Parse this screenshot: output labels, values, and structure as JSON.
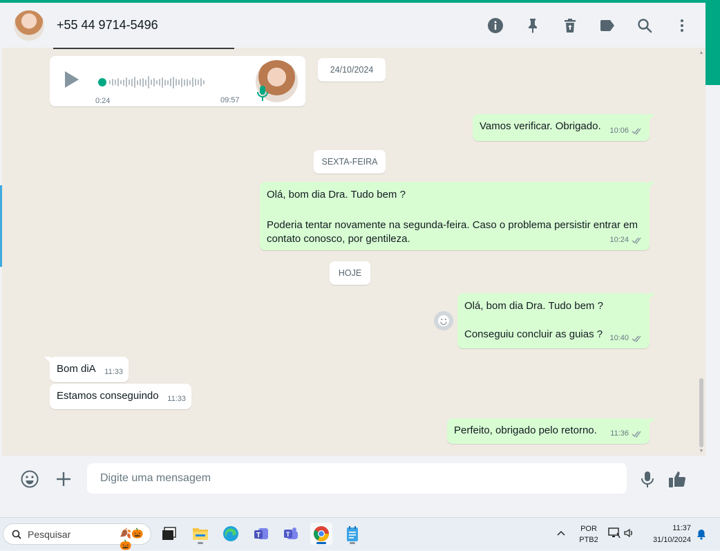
{
  "header": {
    "contact_name": "+55 44 9714-5496",
    "icons": [
      "info-icon",
      "pin-icon",
      "trash-icon",
      "label-icon",
      "search-icon",
      "menu-icon"
    ]
  },
  "voice_message": {
    "current_time": "0:24",
    "duration": "09:57",
    "progress": 0.0
  },
  "date_chips": {
    "d1": "24/10/2024",
    "d2": "SEXTA-FEIRA",
    "d3": "HOJE"
  },
  "messages": {
    "m1": {
      "text": "Vamos verificar. Obrigado.",
      "time": "10:06"
    },
    "m2": {
      "line1": "Olá, bom dia Dra. Tudo bem ?",
      "line2": "Poderia tentar novamente na segunda-feira. Caso o problema persistir entrar em contato conosco, por gentileza.",
      "time": "10:24"
    },
    "m3": {
      "line1": "Olá, bom dia Dra. Tudo bem ?",
      "line2": "Conseguiu concluir as guias ?",
      "time": "10:40"
    },
    "m4": {
      "text": "Bom diA",
      "time": "11:33"
    },
    "m5": {
      "text": "Estamos conseguindo",
      "time": "11:33"
    },
    "m6": {
      "text": "Perfeito, obrigado pelo retorno.",
      "time": "11:36"
    }
  },
  "composer": {
    "placeholder": "Digite uma mensagem"
  },
  "taskbar": {
    "search_label": "Pesquisar",
    "lang_top": "POR",
    "lang_bottom": "PTB2",
    "time": "11:37",
    "date": "31/10/2024"
  },
  "colors": {
    "accent": "#00a884",
    "outgoing_bubble": "#d9fdd3",
    "incoming_bubble": "#ffffff",
    "chat_bg": "#efeae2",
    "read_ticks": "#8696a0"
  }
}
